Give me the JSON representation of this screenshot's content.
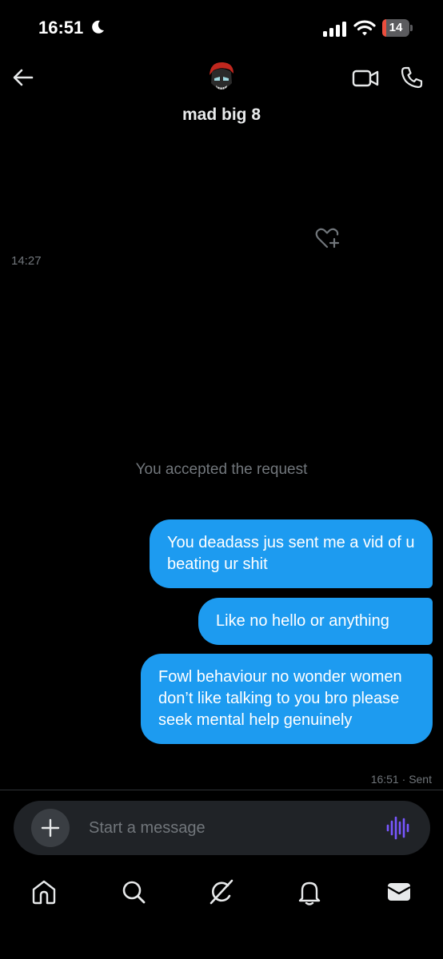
{
  "status_bar": {
    "time": "16:51",
    "battery_level": "14",
    "battery_fraction": 0.14,
    "icons": [
      "moon-icon",
      "signal-icon",
      "wifi-icon",
      "battery-icon"
    ]
  },
  "header": {
    "contact_name": "mad big 8",
    "icons": [
      "back-arrow-icon",
      "avatar",
      "video-call-icon",
      "phone-call-icon"
    ]
  },
  "chat": {
    "first_timestamp": "14:27",
    "system_message": "You accepted the request",
    "messages": [
      {
        "text": "You deadass jus sent me a vid of u beating ur shit",
        "from": "me"
      },
      {
        "text": "Like no hello or anything",
        "from": "me"
      },
      {
        "text": "Fowl behaviour no wonder women don’t like talking to you bro please seek mental help genuinely",
        "from": "me"
      }
    ],
    "last_time": "16:51",
    "last_status": "Sent",
    "meta_separator": " · "
  },
  "composer": {
    "placeholder": "Start a message",
    "icons": [
      "add-icon",
      "voice-message-icon"
    ]
  },
  "bottom_nav": {
    "items": [
      "home-icon",
      "search-icon",
      "grok-icon",
      "notifications-icon",
      "messages-icon"
    ]
  },
  "colors": {
    "background": "#000000",
    "bubble": "#1d9bf0",
    "muted": "#71767b",
    "voice_accent": "#7856ff",
    "battery_low": "#eb4e3d"
  }
}
